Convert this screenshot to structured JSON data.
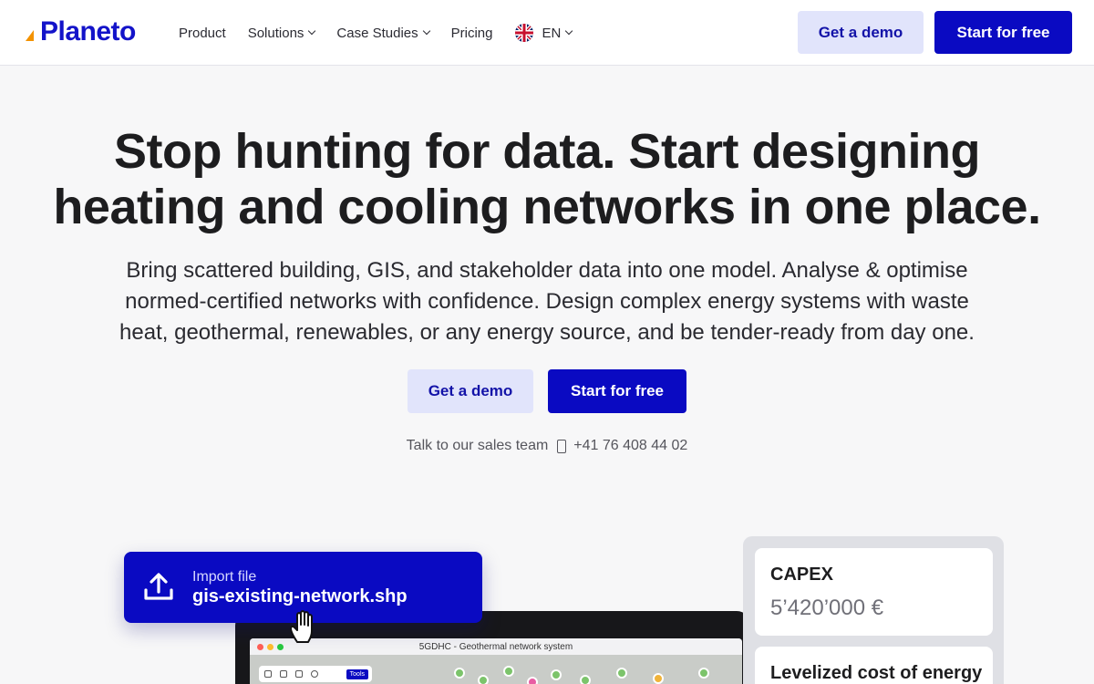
{
  "nav": {
    "logo_text": "Planeto",
    "links": [
      {
        "label": "Product",
        "has_dropdown": false
      },
      {
        "label": "Solutions",
        "has_dropdown": true
      },
      {
        "label": "Case Studies",
        "has_dropdown": true
      },
      {
        "label": "Pricing",
        "has_dropdown": false
      }
    ],
    "language": "EN",
    "demo_label": "Get a demo",
    "free_label": "Start for free"
  },
  "hero": {
    "title_line1": "Stop hunting for data. Start designing",
    "title_line2": "heating and cooling networks in one place.",
    "subtitle_line1": "Bring scattered building, GIS, and stakeholder data into one model. Analyse & optimise",
    "subtitle_line2": "normed-certified networks with confidence. Design complex energy systems with waste",
    "subtitle_line3": "heat, geothermal, renewables, or any energy source, and be tender-ready from day one.",
    "demo_label": "Get a demo",
    "free_label": "Start for free",
    "sales_text": "Talk to our sales team",
    "sales_phone": "+41 76 408 44 02"
  },
  "visual": {
    "import_label": "Import file",
    "import_filename": "gis-existing-network.shp",
    "app_title": "5GDHC - Geothermal network system",
    "tools_label": "Tools",
    "stats": [
      {
        "label": "CAPEX",
        "value": "5’420’000 €"
      },
      {
        "label": "Levelized cost of energy",
        "value": ""
      }
    ]
  },
  "colors": {
    "brand_blue": "#0a0ac2",
    "brand_orange": "#f39200",
    "soft_button": "#e1e4fb",
    "background": "#f7f7f8"
  },
  "icons": [
    "chevron-down-icon",
    "uk-flag-icon",
    "phone-icon",
    "upload-icon",
    "hand-cursor-icon"
  ]
}
